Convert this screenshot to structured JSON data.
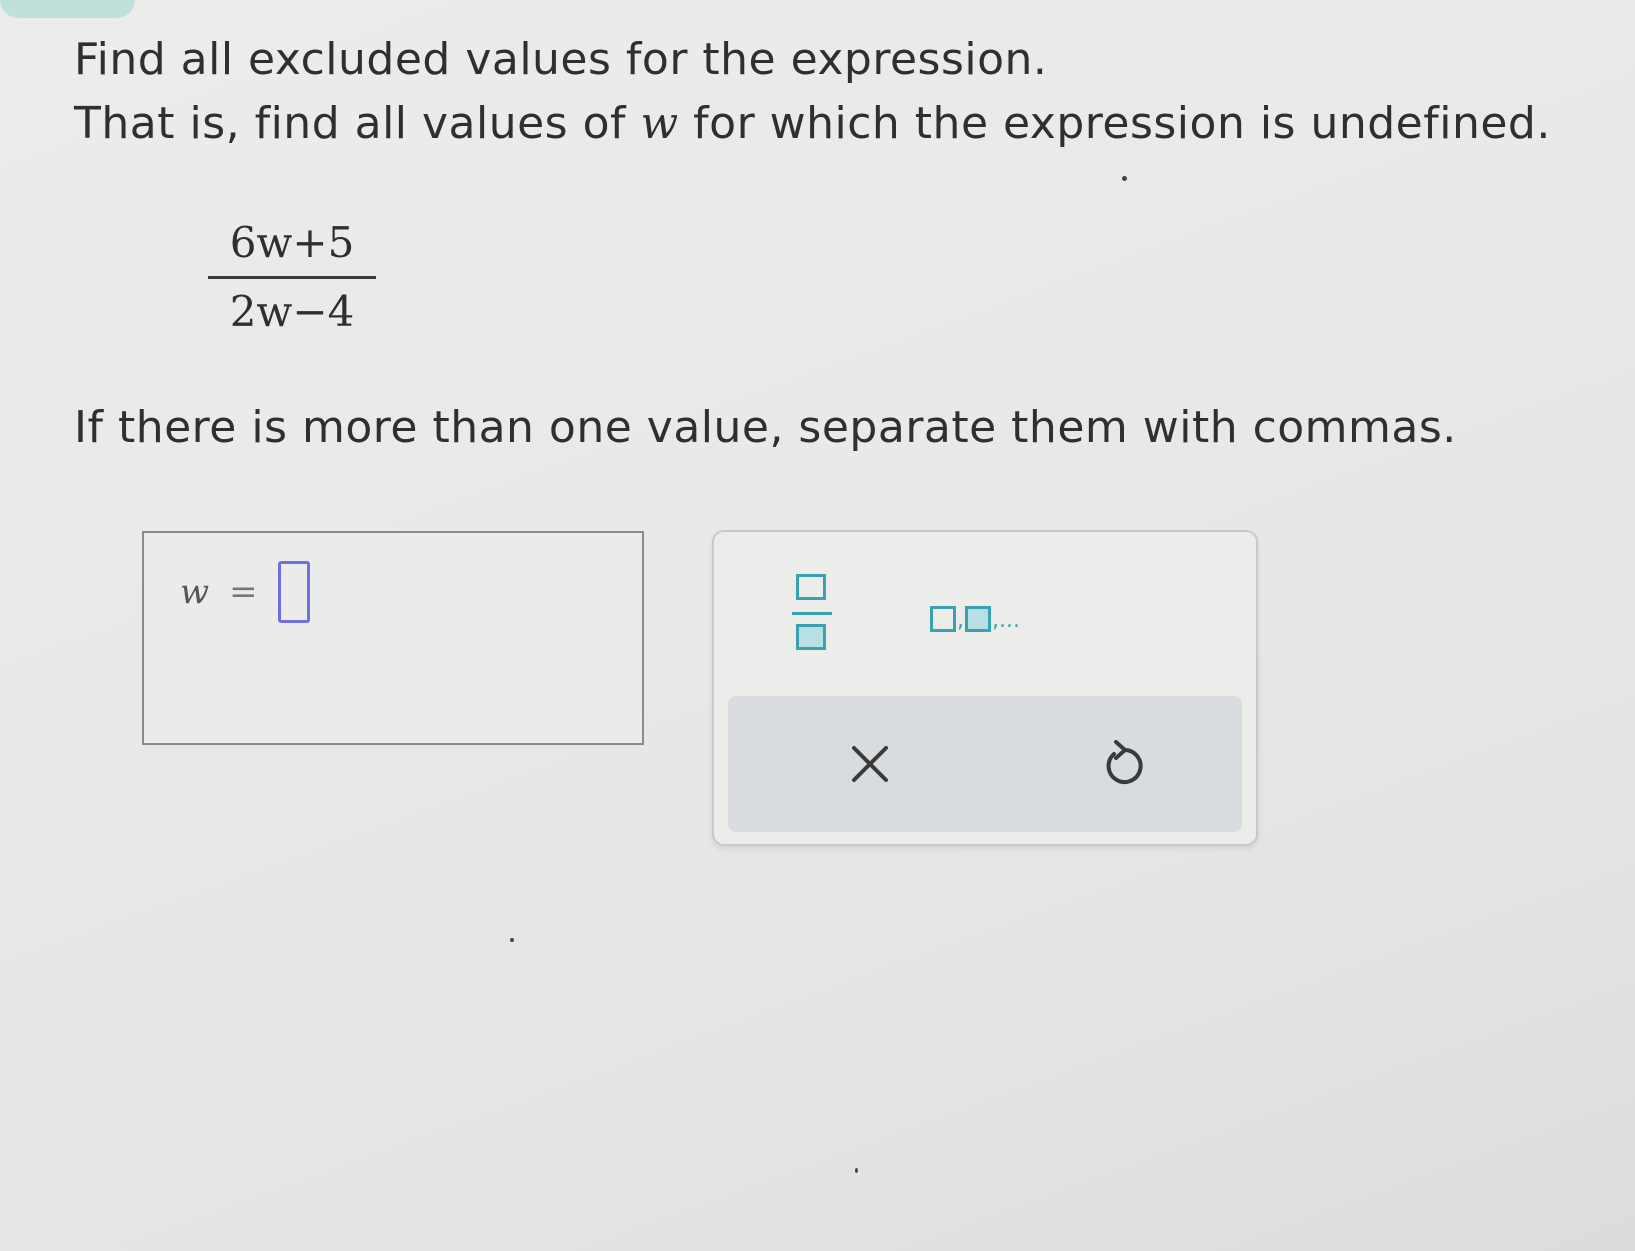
{
  "instructions": {
    "line1": "Find all excluded values for the expression.",
    "line2_prefix": "That is, find all values of ",
    "line2_variable": "w",
    "line2_suffix": " for which the expression is undefined.",
    "line3": "If there is more than one value, separate them with commas."
  },
  "expression": {
    "numerator": "6w+5",
    "denominator": "2w−4"
  },
  "answer": {
    "variable": "w",
    "equals": "=",
    "value": ""
  },
  "toolbar": {
    "fraction_icon": "fraction-template-icon",
    "list_icon": "comma-list-template-icon",
    "list_ellipsis": ",...",
    "list_separator": ",",
    "clear_icon": "close-icon",
    "undo_icon": "undo-icon"
  },
  "colors": {
    "accent": "#3aa1b0",
    "input_border": "#6f6fe0",
    "tab": "#bfe0db"
  }
}
